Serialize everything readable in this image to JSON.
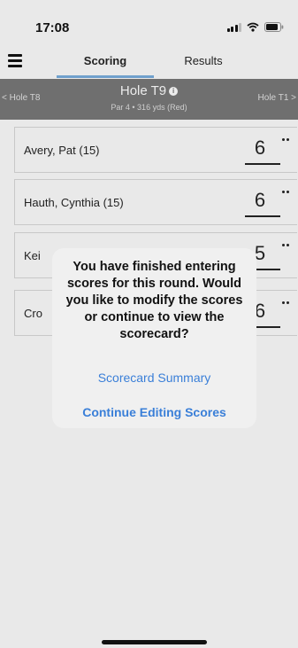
{
  "status_bar": {
    "time": "17:08"
  },
  "tabs": {
    "scoring": "Scoring",
    "results": "Results"
  },
  "hole": {
    "prev_label": "< Hole T8",
    "next_label": "Hole T1 >",
    "title": "Hole T9",
    "info_glyph": "i",
    "subtitle": "Par 4 • 316 yds (Red)"
  },
  "players": [
    {
      "name": "Avery, Pat (15)",
      "score": "6"
    },
    {
      "name": "Hauth, Cynthia (15)",
      "score": "6"
    },
    {
      "name": "Kei",
      "score": "5"
    },
    {
      "name": "Cro",
      "score": "6"
    }
  ],
  "dialog": {
    "message": "You have finished entering scores for this round. Would you like to modify the scores or continue to view the scorecard?",
    "summary_button": "Scorecard Summary",
    "continue_button": "Continue Editing Scores"
  },
  "colors": {
    "accent": "#3a7fd8",
    "tab_underline": "#6fa0cc",
    "hole_header_bg": "#6f6f6f"
  }
}
